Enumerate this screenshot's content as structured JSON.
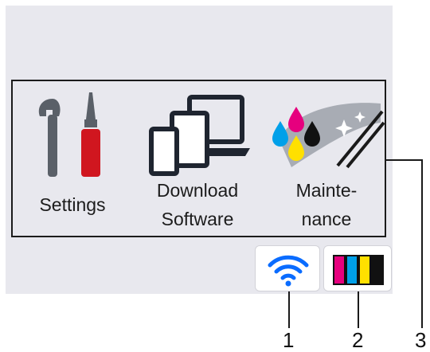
{
  "menu": {
    "items": [
      {
        "label": "Settings",
        "icon": "settings-tools-icon"
      },
      {
        "label_line1": "Download",
        "label_line2": "Software",
        "icon": "devices-icon"
      },
      {
        "label_line1": "Mainte-",
        "label_line2": "nance",
        "icon": "ink-maintenance-icon"
      }
    ]
  },
  "status": {
    "wifi_icon": "wifi-icon",
    "ink_icon": "ink-levels-icon",
    "ink_colors": [
      "#e6007e",
      "#00a0e9",
      "#ffe000",
      "#111111"
    ]
  },
  "callouts": [
    "1",
    "2",
    "3"
  ],
  "colors": {
    "screen_bg": "#e8e8ee",
    "accent_blue": "#0a6cff",
    "tool_red": "#d0161f",
    "tool_gray": "#5a6068"
  }
}
